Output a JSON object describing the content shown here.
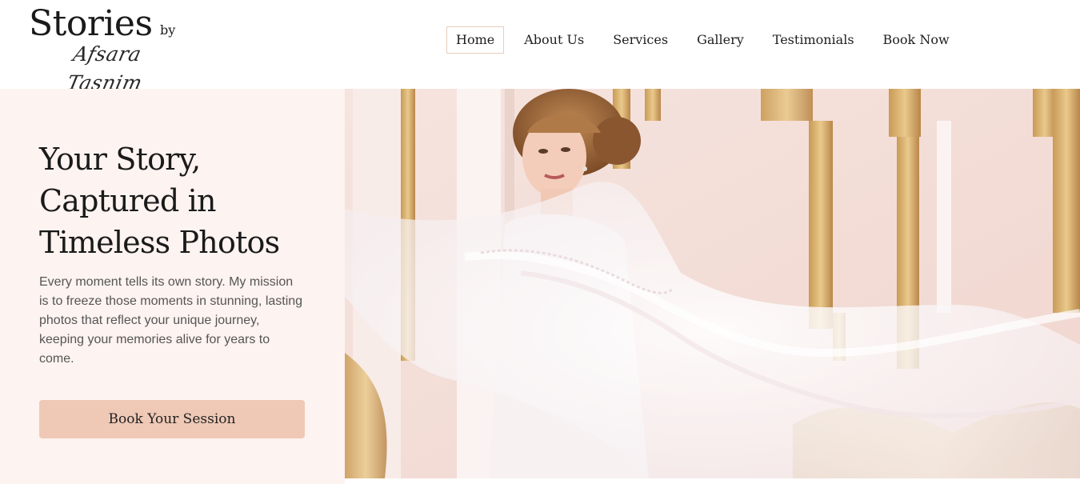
{
  "brand": {
    "name": "Stories",
    "by": "by",
    "photographer": "Afsara Tasnim"
  },
  "nav": {
    "items": [
      {
        "label": "Home",
        "active": true
      },
      {
        "label": "About Us",
        "active": false
      },
      {
        "label": "Services",
        "active": false
      },
      {
        "label": "Gallery",
        "active": false
      },
      {
        "label": "Testimonials",
        "active": false
      },
      {
        "label": "Book Now",
        "active": false
      }
    ]
  },
  "hero": {
    "title_lines": [
      "Your Story,",
      "Captured in",
      "Timeless Photos"
    ],
    "description": "Every moment tells its own story. My mission is to freeze those moments in stunning, lasting photos that reflect your unique journey, keeping your memories alive for years to come.",
    "cta_label": "Book Your Session"
  },
  "colors": {
    "accent": "#efc9b6",
    "hero_bg": "#fdf3f0",
    "nav_active_border": "#eacdbd"
  }
}
